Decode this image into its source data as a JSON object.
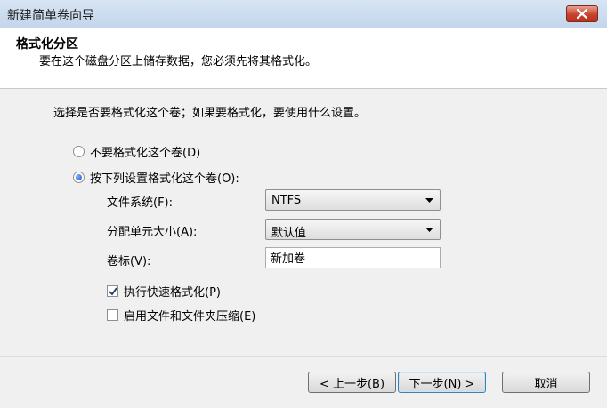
{
  "window": {
    "title": "新建简单卷向导"
  },
  "header": {
    "title": "格式化分区",
    "subtitle": "要在这个磁盘分区上储存数据，您必须先将其格式化。"
  },
  "prompt": "选择是否要格式化这个卷；如果要格式化，要使用什么设置。",
  "options": {
    "no_format": {
      "label": "不要格式化这个卷(D)",
      "selected": false
    },
    "format": {
      "label": "按下列设置格式化这个卷(O):",
      "selected": true
    }
  },
  "settings": {
    "filesystem": {
      "label": "文件系统(F):",
      "value": "NTFS"
    },
    "alloc_size": {
      "label": "分配单元大小(A):",
      "value": "默认值"
    },
    "volume_label": {
      "label": "卷标(V):",
      "value": "新加卷"
    }
  },
  "checks": {
    "quick_format": {
      "label": "执行快速格式化(P)",
      "checked": true
    },
    "compression": {
      "label": "启用文件和文件夹压缩(E)",
      "checked": false
    }
  },
  "buttons": {
    "back": "< 上一步(B)",
    "next": "下一步(N) >",
    "cancel": "取消"
  }
}
